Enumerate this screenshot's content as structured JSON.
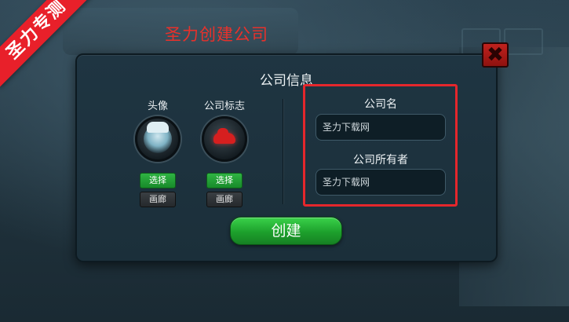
{
  "ribbon": {
    "text": "圣力专测"
  },
  "page": {
    "title": "圣力创建公司"
  },
  "dialog": {
    "title": "公司信息",
    "close_symbol": "✖",
    "avatar": {
      "label": "头像",
      "select_label": "选择",
      "gallery_label": "画廊"
    },
    "logo": {
      "label": "公司标志",
      "select_label": "选择",
      "gallery_label": "画廊"
    },
    "company_name": {
      "label": "公司名",
      "value": "圣力下载网"
    },
    "owner": {
      "label": "公司所有者",
      "value": "圣力下载网"
    },
    "create_label": "创建"
  },
  "icons": {
    "close": "close-icon",
    "avatar": "avatar-icon",
    "logo": "car-logo-icon"
  },
  "colors": {
    "title_red": "#e8312b",
    "ribbon_red": "#e8202a",
    "button_green": "#2fb443",
    "highlight_red": "#e5272c"
  }
}
